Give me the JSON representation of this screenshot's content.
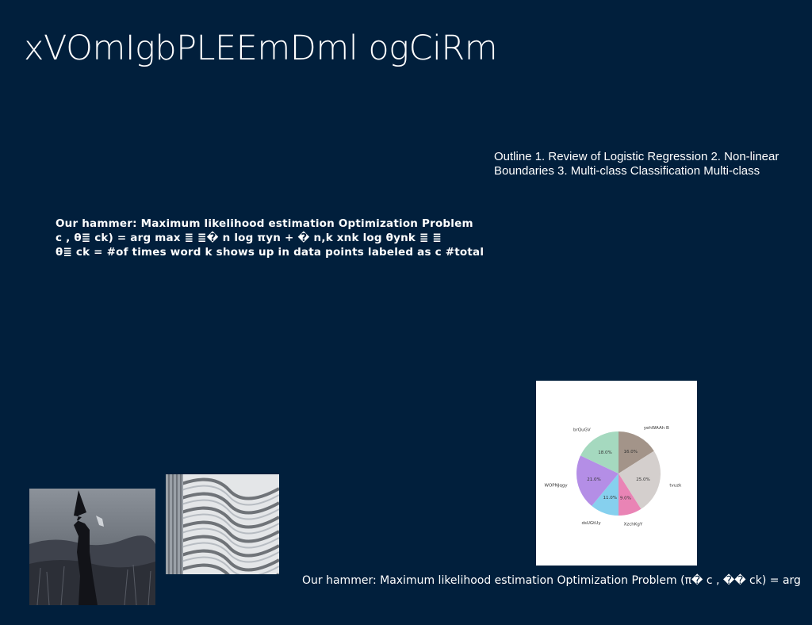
{
  "slide": {
    "title": "xVOmIgbPLEEmDml ogCiRm",
    "outline_text": "Outline 1. Review of Logistic Regression 2. Non-linear Boundaries 3. Multi-class Classification Multi-class",
    "hammer_lines": [
      "Our hammer: Maximum likelihood estimation Optimization Problem",
      "c , θ≣ ck) = arg max ≣ ≣� n log πyn + � n,k xnk log θynk ≣ ≣",
      "θ≣ ck = #of times word k shows up in data points labeled as c #total"
    ],
    "caption": "Our hammer: Maximum likelihood estimation Optimization Problem (π� c , �� ck) = arg"
  },
  "images": {
    "photo_1": "silhouette-figure-photo",
    "photo_2": "curved-building-photo"
  },
  "chart_data": {
    "type": "pie",
    "title": "",
    "categories": [
      "yehWAAh B",
      "tvuzk",
      "XzchKgY",
      "dsUGtUy",
      "WOPNJqgy",
      "brQuGV"
    ],
    "values": [
      16.0,
      25.0,
      9.0,
      11.0,
      21.0,
      18.0
    ],
    "labels": [
      "16.0%",
      "25.0%",
      "9.0%",
      "11.0%",
      "21.0%",
      "18.0%"
    ],
    "colors": [
      "#a39489",
      "#d4cfcd",
      "#e984b5",
      "#86d0ee",
      "#b48ee6",
      "#a5d9bf"
    ],
    "start_angle": 90,
    "direction": "clockwise"
  }
}
